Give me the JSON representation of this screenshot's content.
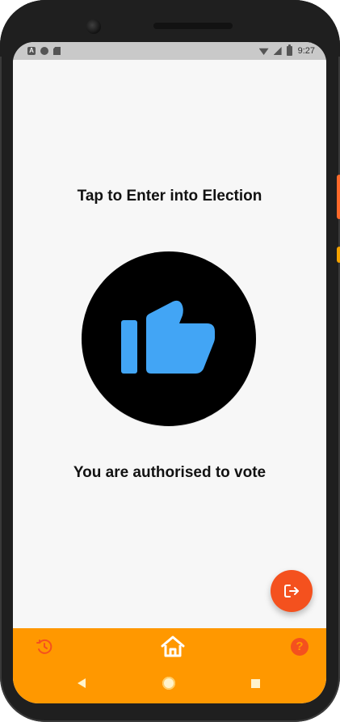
{
  "status_bar": {
    "left_indicator": "A",
    "time": "9:27",
    "icons": [
      "notification-a-icon",
      "circle-status-icon",
      "sd-card-icon",
      "wifi-icon",
      "signal-icon",
      "battery-icon"
    ]
  },
  "main": {
    "title": "Tap to Enter into Election",
    "message": "You are authorised to vote",
    "thumb_icon": "thumbs-up-icon"
  },
  "fab": {
    "icon": "logout-icon"
  },
  "bottom_nav": {
    "items": [
      {
        "icon": "history-icon",
        "selected": false
      },
      {
        "icon": "home-icon",
        "selected": true
      },
      {
        "icon": "help-icon",
        "text": "?"
      }
    ]
  },
  "system_nav": {
    "icons": [
      "back-icon",
      "home-circle-icon",
      "recent-apps-icon"
    ]
  },
  "colors": {
    "screen_bg": "#f7f7f7",
    "status_bar_bg": "#c9c9c9",
    "accent_orange": "#ff9800",
    "fab_red_orange": "#f4511e",
    "thumb_blue": "#42a5f5",
    "circle_black": "#000000",
    "text_dark": "#121212",
    "frame_dark": "#1f1f1f"
  }
}
